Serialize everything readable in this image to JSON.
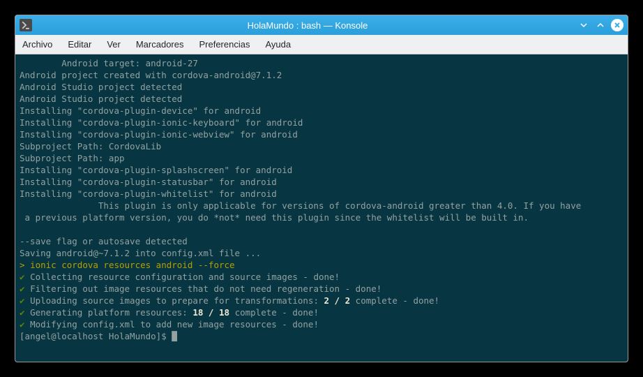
{
  "window": {
    "title": "HolaMundo : bash — Konsole"
  },
  "menubar": {
    "items": [
      "Archivo",
      "Editar",
      "Ver",
      "Marcadores",
      "Preferencias",
      "Ayuda"
    ]
  },
  "terminal": {
    "lines": [
      "        Android target: android-27",
      "Android project created with cordova-android@7.1.2",
      "Android Studio project detected",
      "Android Studio project detected",
      "Installing \"cordova-plugin-device\" for android",
      "Installing \"cordova-plugin-ionic-keyboard\" for android",
      "Installing \"cordova-plugin-ionic-webview\" for android",
      "Subproject Path: CordovaLib",
      "Subproject Path: app",
      "Installing \"cordova-plugin-splashscreen\" for android",
      "Installing \"cordova-plugin-statusbar\" for android",
      "Installing \"cordova-plugin-whitelist\" for android",
      "",
      "               This plugin is only applicable for versions of cordova-android greater than 4.0. If you have",
      " a previous platform version, you do *not* need this plugin since the whitelist will be built in.",
      "          ",
      "--save flag or autosave detected",
      "Saving android@~7.1.2 into config.xml file ..."
    ],
    "command_prefix": "> ",
    "command": "ionic cordova resources android --force",
    "check_lines": [
      {
        "pre": "Collecting resource configuration and source images - done!",
        "bold": ""
      },
      {
        "pre": "Filtering out image resources that do not need regeneration - done!",
        "bold": ""
      },
      {
        "pre": "Uploading source images to prepare for transformations: ",
        "bold": "2 / 2",
        "post": " complete - done!"
      },
      {
        "pre": "Generating platform resources: ",
        "bold": "18 / 18",
        "post": " complete - done!"
      },
      {
        "pre": "Modifying config.xml to add new image resources - done!",
        "bold": ""
      }
    ],
    "prompt": "[angel@localhost HolaMundo]$ "
  }
}
